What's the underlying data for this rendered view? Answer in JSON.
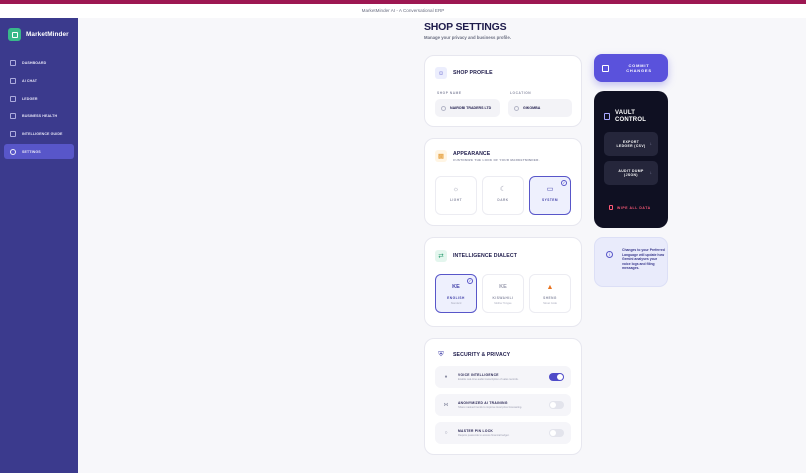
{
  "window": {
    "title": "MarketMinder AI - A Conversational ERP"
  },
  "brand": {
    "name": "MarketMinder"
  },
  "sidebar": {
    "items": [
      {
        "label": "DASHBOARD",
        "active": false
      },
      {
        "label": "AI CHAT",
        "active": false
      },
      {
        "label": "LEDGER",
        "active": false
      },
      {
        "label": "BUSINESS HEALTH",
        "active": false
      },
      {
        "label": "INTELLIGENCE GUIDE",
        "active": false
      },
      {
        "label": "SETTINGS",
        "active": true
      }
    ]
  },
  "page": {
    "title": "SHOP SETTINGS",
    "subtitle": "Manage your privacy and business profile."
  },
  "shop_profile": {
    "title": "SHOP PROFILE",
    "shop_name_label": "SHOP NAME",
    "shop_name_value": "NAIROBI TRADERS LTD",
    "location_label": "LOCATION",
    "location_value": "GIKOMBA"
  },
  "appearance": {
    "title": "APPEARANCE",
    "subtitle": "CUSTOMIZE THE LOOK OF YOUR MARKETMINDER.",
    "options": [
      {
        "label": "LIGHT",
        "icon": "sun-icon",
        "selected": false
      },
      {
        "label": "DARK",
        "icon": "moon-icon",
        "selected": false
      },
      {
        "label": "SYSTEM",
        "icon": "monitor-icon",
        "selected": true
      }
    ]
  },
  "dialect": {
    "title": "INTELLIGENCE DIALECT",
    "options": [
      {
        "code": "KE",
        "label": "ENGLISH",
        "sub": "Standard",
        "selected": true
      },
      {
        "code": "KE",
        "label": "KISWAHILI",
        "sub": "Mother Tongue",
        "selected": false
      },
      {
        "code": "",
        "label": "SHENG",
        "sub": "Street Code",
        "selected": false
      }
    ]
  },
  "privacy": {
    "title": "SECURITY & PRIVACY",
    "rows": [
      {
        "title": "VOICE INTELLIGENCE",
        "desc": "Enable real-time audio transcription of sales records.",
        "enabled": true
      },
      {
        "title": "ANONYMIZED AI TRAINING",
        "desc": "Share masked trends to improve local price forecasting.",
        "enabled": false
      },
      {
        "title": "MASTER PIN LOCK",
        "desc": "Require passcode to access financial ledger.",
        "enabled": false
      }
    ]
  },
  "commit": {
    "label": "COMMIT CHANGES"
  },
  "vault": {
    "title": "VAULT CONTROL",
    "export_label": "EXPORT LEDGER (CSV)",
    "audit_label": "AUDIT DUMP (JSON)",
    "wipe_label": "WIPE ALL DATA"
  },
  "info": {
    "text": "Changes to your Preferred Language will update how Gemini analyses your voice logs and filing messages."
  },
  "colors": {
    "sidebar": "#3b3a8d",
    "accent": "#5856c9",
    "topbar_stripe": "#9d1752",
    "danger": "#ff5a78",
    "vault_bg": "#0f1022"
  }
}
